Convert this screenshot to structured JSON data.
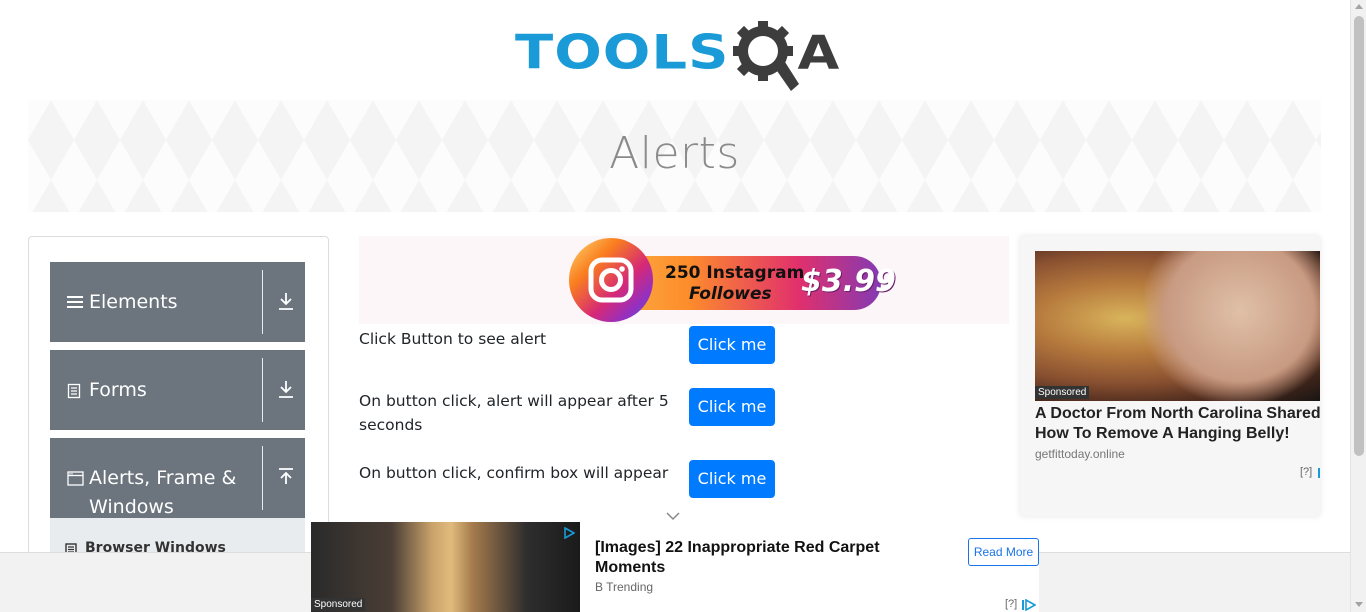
{
  "header": {
    "logo_text_main": "TOOLS",
    "logo_text_tail": "A",
    "logo_icon": "gear-magnifier-icon",
    "brand_blue": "#1a9bd7",
    "brand_dark": "#3d3d3d"
  },
  "banner": {
    "title": "Alerts"
  },
  "sidebar": {
    "groups": [
      {
        "label": "Elements",
        "icon": "hamburger-icon",
        "arrow": "download-arrow-icon",
        "expanded": false
      },
      {
        "label": "Forms",
        "icon": "document-icon",
        "arrow": "download-arrow-icon",
        "expanded": false
      },
      {
        "label": "Alerts, Frame & Windows",
        "icon": "window-icon",
        "arrow": "upload-arrow-icon",
        "expanded": true
      }
    ],
    "subitems": [
      {
        "label": "Browser Windows",
        "icon": "list-icon"
      }
    ],
    "group_color": "#6c757d"
  },
  "promo": {
    "line1": "250 Instagram",
    "line2": "Followes",
    "price": "$3.99"
  },
  "alerts": [
    {
      "text": "Click Button to see alert",
      "button": "Click me"
    },
    {
      "text": "On button click, alert will appear after 5 seconds",
      "button": "Click me"
    },
    {
      "text": "On button click, confirm box will appear",
      "button": "Click me"
    }
  ],
  "button_color": "#007bff",
  "right_ad": {
    "sponsored": "Sponsored",
    "title": "A Doctor From North Carolina Shared How To Remove A Hanging Belly!",
    "source": "getfittoday.online",
    "help": "[?]"
  },
  "bottom_ad": {
    "sponsored": "Sponsored",
    "title": "[Images] 22 Inappropriate Red Carpet Moments",
    "source": "B Trending",
    "cta": "Read More",
    "help": "[?]"
  }
}
